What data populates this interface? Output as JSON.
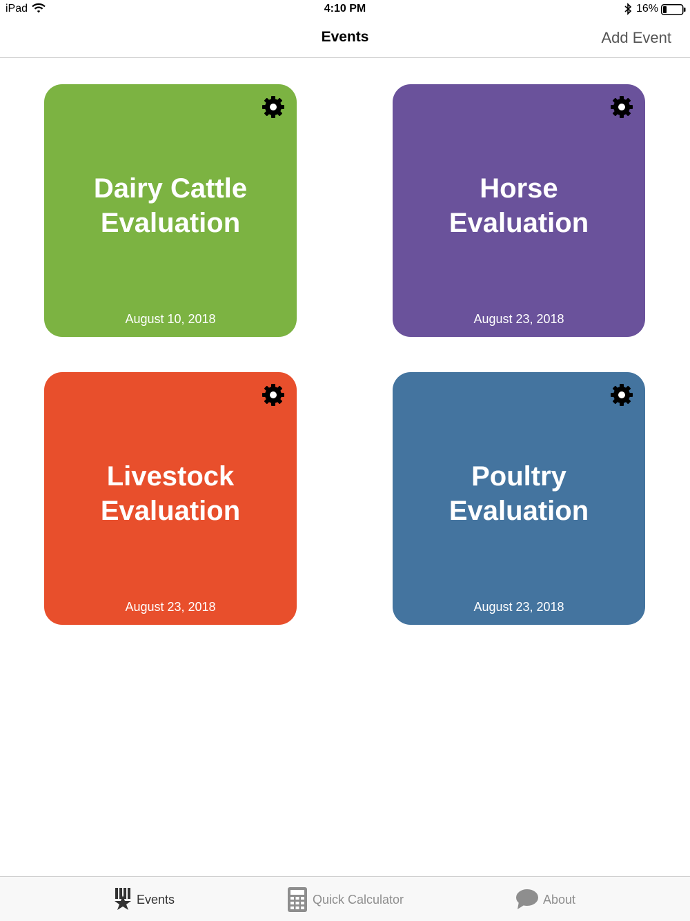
{
  "status_bar": {
    "device": "iPad",
    "time": "4:10 PM",
    "battery": "16%"
  },
  "nav": {
    "title": "Events",
    "add_label": "Add Event"
  },
  "events": [
    {
      "title_line1": "Dairy Cattle",
      "title_line2": "Evaluation",
      "date": "August 10, 2018",
      "color": "#7cb342"
    },
    {
      "title_line1": "Horse",
      "title_line2": "Evaluation",
      "date": "August 23, 2018",
      "color": "#6a529b"
    },
    {
      "title_line1": "Livestock",
      "title_line2": "Evaluation",
      "date": "August 23, 2018",
      "color": "#e84f2c"
    },
    {
      "title_line1": "Poultry",
      "title_line2": "Evaluation",
      "date": "August 23, 2018",
      "color": "#44749f"
    }
  ],
  "tabs": [
    {
      "label": "Events",
      "icon": "ribbon-star-icon",
      "active": true
    },
    {
      "label": "Quick Calculator",
      "icon": "calculator-icon",
      "active": false
    },
    {
      "label": "About",
      "icon": "speech-bubble-icon",
      "active": false
    }
  ],
  "colors": {
    "tab_active": "#333333",
    "tab_inactive": "#8e8e8e"
  }
}
